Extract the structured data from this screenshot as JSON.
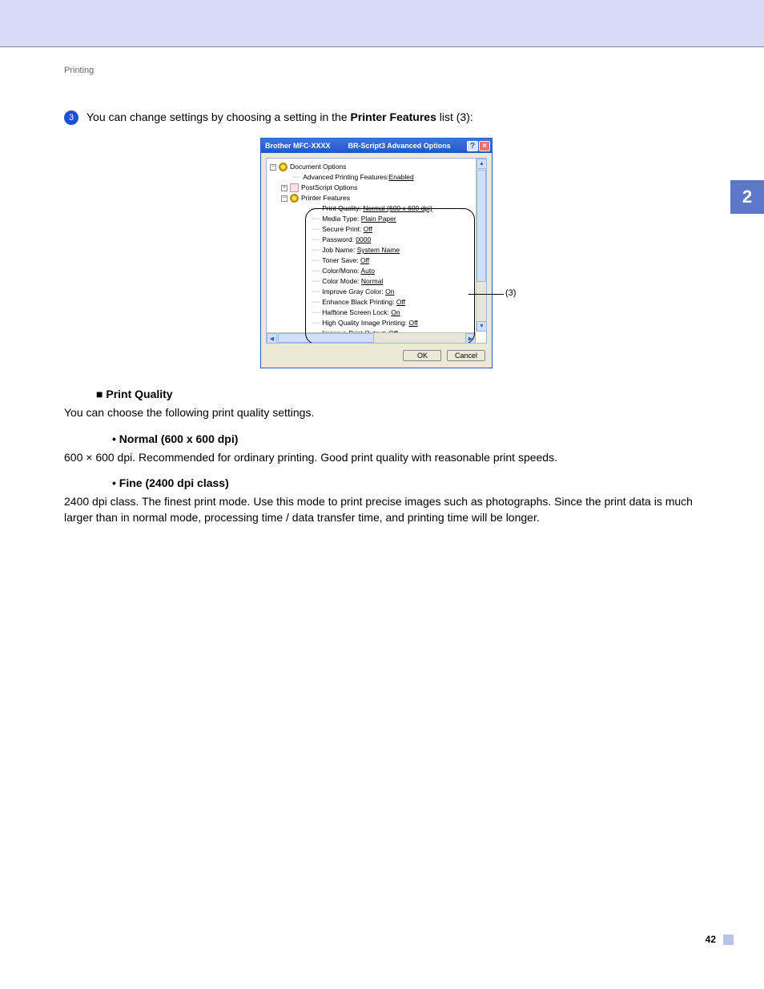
{
  "running_head": "Printing",
  "section_tab": "2",
  "page_number": "42",
  "step": {
    "num": "3",
    "text_a": "You can change settings by choosing a setting in the ",
    "text_b": "Printer Features",
    "text_c": " list (3):"
  },
  "dialog": {
    "title_left": "Brother MFC-XXXX",
    "title_right": "BR-Script3 Advanced Options",
    "help": "?",
    "close": "×",
    "root": "Document Options",
    "adv_label": "Advanced Printing Features: ",
    "adv_val": "Enabled",
    "postscript": "PostScript Options",
    "printer_features": "Printer Features",
    "settings": [
      {
        "label": "Print Quality: ",
        "val": "Normal (600 x 600 dpi)"
      },
      {
        "label": "Media Type: ",
        "val": "Plain Paper"
      },
      {
        "label": "Secure Print: ",
        "val": "Off"
      },
      {
        "label": "Password: ",
        "val": "0000"
      },
      {
        "label": "Job Name: ",
        "val": "System Name"
      },
      {
        "label": "Toner Save: ",
        "val": "Off"
      },
      {
        "label": "Color/Mono: ",
        "val": "Auto"
      },
      {
        "label": "Color Mode: ",
        "val": "Normal"
      },
      {
        "label": "Improve Gray Color: ",
        "val": "On"
      },
      {
        "label": "Enhance Black Printing: ",
        "val": "Off"
      },
      {
        "label": "Halftone Screen Lock: ",
        "val": "On"
      },
      {
        "label": "High Quality Image Printing: ",
        "val": "Off"
      },
      {
        "label": "Improve Print Output: ",
        "val": "Off"
      }
    ],
    "ok": "OK",
    "cancel": "Cancel",
    "callout": "(3)"
  },
  "body": {
    "pq_head": "Print Quality",
    "pq_text": "You can choose the following print quality settings.",
    "normal_head": "Normal (600 x 600 dpi)",
    "normal_text": "600 × 600 dpi. Recommended for ordinary printing. Good print quality with reasonable print speeds.",
    "fine_head": "Fine (2400 dpi class)",
    "fine_text": "2400 dpi class. The finest print mode. Use this mode to print precise images such as photographs. Since the print data is much larger than in normal mode, processing time / data transfer time, and printing time will be longer."
  }
}
